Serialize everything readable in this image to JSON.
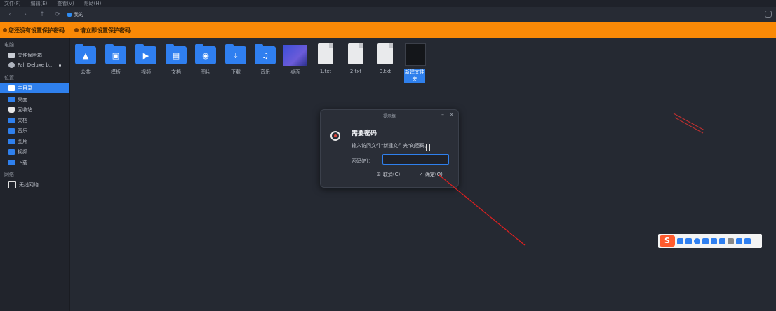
{
  "menubar": {
    "items": [
      "文件(F)",
      "编辑(E)",
      "查看(V)",
      "帮助(H)"
    ]
  },
  "toolbar": {
    "location": "我的"
  },
  "banner": {
    "warn1": "您还没有设置保护密码",
    "warn2": "请立即设置保护密码"
  },
  "sidebar": {
    "section_computer": "电脑",
    "items": [
      {
        "label": "文件保险箱",
        "icon": "vault-icon"
      },
      {
        "label": "Fall Deluxe b...",
        "icon": "disc-icon"
      }
    ],
    "section_locations": "位置",
    "locations": [
      {
        "label": "主目录",
        "icon": "home-icon"
      },
      {
        "label": "桌面",
        "icon": "desktop-icon"
      },
      {
        "label": "回收站",
        "icon": "trash-icon"
      },
      {
        "label": "文档",
        "icon": "folder-icon"
      },
      {
        "label": "音乐",
        "icon": "folder-icon"
      },
      {
        "label": "图片",
        "icon": "folder-icon"
      },
      {
        "label": "视频",
        "icon": "folder-icon"
      },
      {
        "label": "下载",
        "icon": "folder-icon"
      }
    ],
    "section_network": "网络",
    "network": [
      {
        "label": "无线网络",
        "icon": "monitor-icon"
      }
    ]
  },
  "files": [
    {
      "name": "公共",
      "glyph": "▲"
    },
    {
      "name": "模板",
      "glyph": "▣"
    },
    {
      "name": "视频",
      "glyph": "▶"
    },
    {
      "name": "文档",
      "glyph": "▤"
    },
    {
      "name": "图片",
      "glyph": "◉"
    },
    {
      "name": "下载",
      "glyph": "↓"
    },
    {
      "name": "音乐",
      "glyph": "♫"
    },
    {
      "name": "桌面"
    },
    {
      "name": "1.txt"
    },
    {
      "name": "2.txt"
    },
    {
      "name": "3.txt"
    },
    {
      "name": "新建文件夹"
    }
  ],
  "dialog": {
    "title": "提示框",
    "minimize": "–",
    "close": "×",
    "heading": "需要密码",
    "message": "输入访问文件\"新建文件夹\"的密码。",
    "password_label": "密码(P)：",
    "password_value": "",
    "cancel": "取消(C)",
    "ok": "确定(O)"
  },
  "ime": {
    "logo": "S"
  },
  "colors": {
    "accent": "#2f80ed",
    "banner": "#fa8906",
    "background": "#252932",
    "annotation": "#e02020"
  }
}
